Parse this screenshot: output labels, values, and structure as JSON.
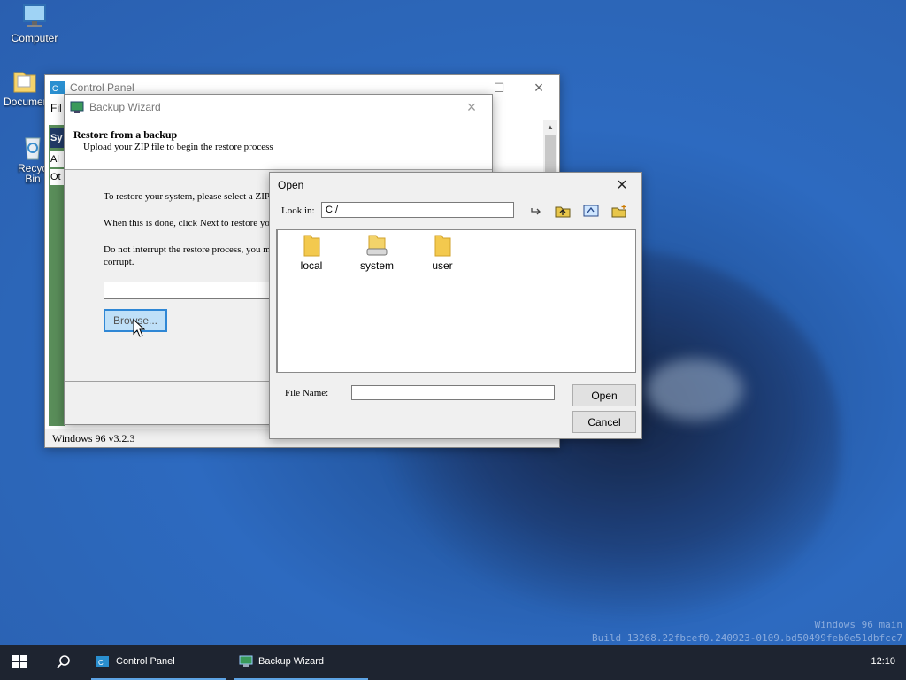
{
  "desktop": {
    "icons": [
      {
        "label": "Computer"
      },
      {
        "label": "Documents"
      },
      {
        "label": "Recycle Bin"
      }
    ],
    "watermark": {
      "line1": "Windows 96 main",
      "line2": "Build 13268.22fbcef0.240923-0109.bd50499feb0e51dbfcc7"
    }
  },
  "control_panel": {
    "title": "Control Panel",
    "menu_first": "Fil",
    "sidebar_items": [
      "Sy",
      "Al",
      "Ot"
    ],
    "status": "Windows 96 v3.2.3"
  },
  "backup_wizard": {
    "title": "Backup Wizard",
    "heading": "Restore from a backup",
    "subheading": "Upload your ZIP file to begin the restore process",
    "para1": "To restore your system, please select a ZIP",
    "para2": "When this is done, click Next to restore yo",
    "para3_line1": "Do not interrupt the restore process, you m",
    "para3_line2": "corrupt.",
    "file_input_value": "",
    "browse_label": "Browse..."
  },
  "open_dialog": {
    "title": "Open",
    "look_in_label": "Look in:",
    "look_in_value": "C:/",
    "folders": [
      {
        "label": "local",
        "icon": "folder-icon"
      },
      {
        "label": "system",
        "icon": "system-folder-icon"
      },
      {
        "label": "user",
        "icon": "folder-icon"
      }
    ],
    "file_name_label": "File Name:",
    "file_name_value": "",
    "open_label": "Open",
    "cancel_label": "Cancel"
  },
  "taskbar": {
    "items": [
      {
        "label": "Control Panel"
      },
      {
        "label": "Backup Wizard"
      }
    ],
    "clock": "12:10"
  },
  "colors": {
    "taskbar_bg": "#1e2430",
    "accent": "#5da3e4",
    "browse_bg": "#bfe0f8",
    "browse_border": "#2f87d5"
  }
}
